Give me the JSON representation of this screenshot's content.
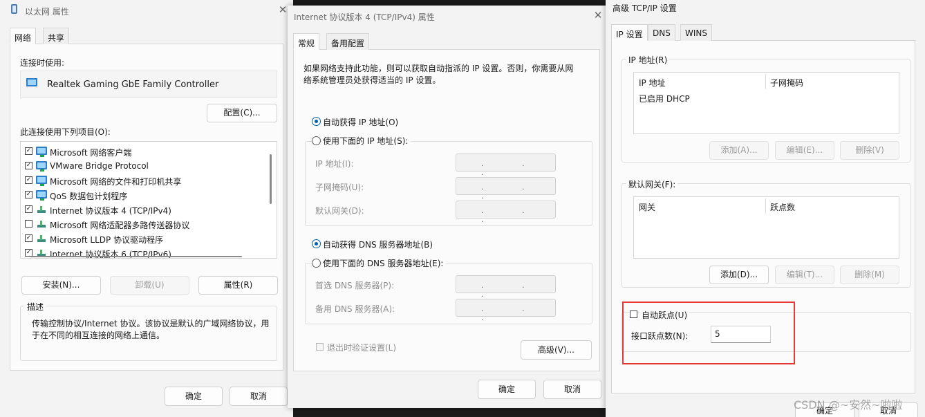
{
  "win1": {
    "title": "以太网 属性",
    "tabs": [
      "网络",
      "共享"
    ],
    "connect_using_label": "连接时使用:",
    "adapter_name": "Realtek Gaming GbE Family Controller",
    "configure_button": "配置(C)...",
    "items_label": "此连接使用下列项目(O):",
    "items": [
      {
        "label": "Microsoft 网络客户端",
        "checked": true,
        "icon": "monitor-icon"
      },
      {
        "label": "VMware Bridge Protocol",
        "checked": true,
        "icon": "monitor-icon"
      },
      {
        "label": "Microsoft 网络的文件和打印机共享",
        "checked": true,
        "icon": "monitor-icon"
      },
      {
        "label": "QoS 数据包计划程序",
        "checked": true,
        "icon": "monitor-icon"
      },
      {
        "label": "Internet 协议版本 4 (TCP/IPv4)",
        "checked": true,
        "icon": "protocol-icon"
      },
      {
        "label": "Microsoft 网络适配器多路传送器协议",
        "checked": false,
        "icon": "protocol-icon"
      },
      {
        "label": "Microsoft LLDP 协议驱动程序",
        "checked": true,
        "icon": "protocol-icon"
      },
      {
        "label": "Internet 协议版本 6 (TCP/IPv6)",
        "checked": true,
        "icon": "protocol-icon"
      }
    ],
    "install_button": "安装(N)...",
    "uninstall_button": "卸载(U)",
    "properties_button": "属性(R)",
    "description_title": "描述",
    "description_line1": "传输控制协议/Internet 协议。该协议是默认的广域网络协议，用",
    "description_line2": "于在不同的相互连接的网络上通信。",
    "ok_button": "确定",
    "cancel_button": "取消"
  },
  "win2": {
    "title": "Internet 协议版本 4 (TCP/IPv4) 属性",
    "tabs": [
      "常规",
      "备用配置"
    ],
    "intro_line1": "如果网络支持此功能，则可以获取自动指派的 IP 设置。否则，你需要从网",
    "intro_line2": "络系统管理员处获得适当的 IP 设置。",
    "auto_ip_label": "自动获得 IP 地址(O)",
    "manual_ip_label": "使用下面的 IP 地址(S):",
    "ip_address_label": "IP 地址(I):",
    "subnet_label": "子网掩码(U):",
    "gateway_label": "默认网关(D):",
    "auto_dns_label": "自动获得 DNS 服务器地址(B)",
    "manual_dns_label": "使用下面的 DNS 服务器地址(E):",
    "preferred_dns_label": "首选 DNS 服务器(P):",
    "alternate_dns_label": "备用 DNS 服务器(A):",
    "validate_label": "退出时验证设置(L)",
    "advanced_button": "高级(V)...",
    "ok_button": "确定",
    "cancel_button": "取消",
    "ip_placeholder": ". . ."
  },
  "win3": {
    "title": "高级 TCP/IP 设置",
    "tabs": [
      "IP 设置",
      "DNS",
      "WINS"
    ],
    "ip_group_label": "IP 地址(R)",
    "ip_col_address": "IP 地址",
    "ip_col_mask": "子网掩码",
    "ip_row_value": "已启用 DHCP",
    "add_button": "添加(A)...",
    "edit_button": "编辑(E)...",
    "remove_button": "删除(V)",
    "gw_group_label": "默认网关(F):",
    "gw_col_gateway": "网关",
    "gw_col_metric": "跃点数",
    "gw_add_button": "添加(D)...",
    "gw_edit_button": "编辑(T)...",
    "gw_remove_button": "删除(M)",
    "auto_metric_label": "自动跃点(U)",
    "interface_metric_label": "接口跃点数(N):",
    "interface_metric_value": "5",
    "ok_button": "确定",
    "cancel_button": "取消"
  },
  "watermark": "CSDN @~安然~啦啦"
}
